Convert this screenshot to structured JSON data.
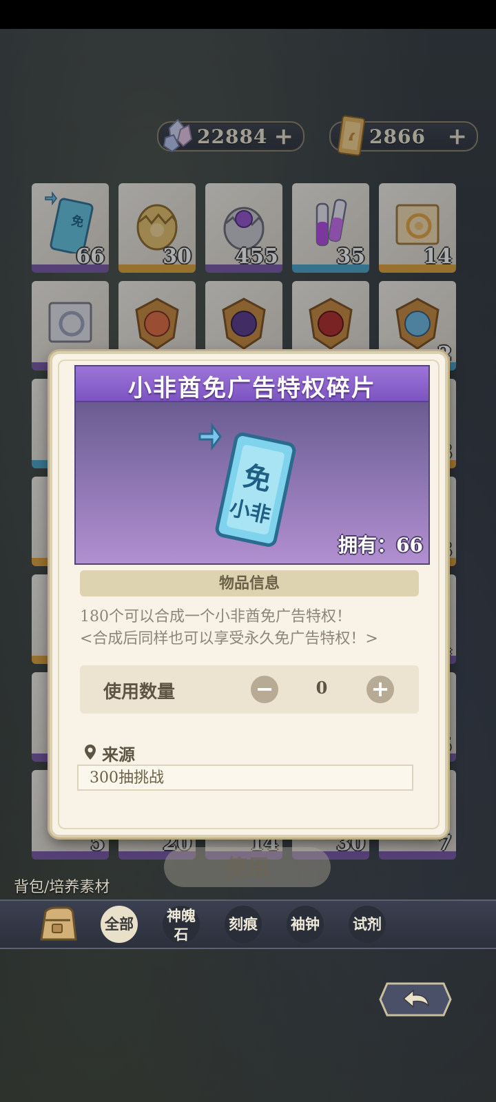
{
  "currency": {
    "gems": "22884",
    "tickets": "2866",
    "plus_symbol": "+"
  },
  "grid": {
    "row1": [
      {
        "count": "66",
        "rarity": "purple",
        "icon": "ad-free-ticket-fragment-icon"
      },
      {
        "count": "30",
        "rarity": "gold",
        "icon": "golden-egg-icon"
      },
      {
        "count": "455",
        "rarity": "purple",
        "icon": "purple-egg-icon"
      },
      {
        "count": "35",
        "rarity": "blue",
        "icon": "potion-vials-icon"
      },
      {
        "count": "14",
        "rarity": "gold",
        "icon": "golden-scroll-icon"
      }
    ],
    "row2_icons": [
      "silver-scroll-icon",
      "fire-emblem-icon",
      "shadow-emblem-icon",
      "dragon-emblem-icon",
      "ice-emblem-icon"
    ],
    "row2_count_last": "2",
    "side_counts_right": [
      "8",
      "8",
      "4",
      "5",
      "5"
    ],
    "row7": [
      {
        "count": "5"
      },
      {
        "count": "20"
      },
      {
        "count": "14"
      },
      {
        "count": "30"
      },
      {
        "count": "7"
      }
    ]
  },
  "dialog": {
    "title": "小非酋免广告特权碎片",
    "owned_label": "拥有：",
    "owned_count": "66",
    "section_title": "物品信息",
    "desc_line1": "180个可以合成一个小非酋免广告特权！",
    "desc_line2": "<合成后同样也可以享受永久免广告特权！>",
    "usage_label": "使用数量",
    "minus": "−",
    "plus": "+",
    "quantity": "0",
    "source_label": "来源",
    "source_value": "300抽挑战"
  },
  "use_button": "使用",
  "breadcrumb": "背包/培养素材",
  "tabs": [
    {
      "label": "全部",
      "active": true
    },
    {
      "label_line1": "神魄",
      "label_line2": "石",
      "active": false
    },
    {
      "label": "刻痕",
      "active": false
    },
    {
      "label": "袖钟",
      "active": false
    },
    {
      "label": "试剂",
      "active": false
    }
  ],
  "colors": {
    "purple_rarity": "#7a58a8",
    "gold_rarity": "#e0a23a",
    "blue_rarity": "#4aa3c9",
    "dialog_bg": "#f8f3e6",
    "title_bar": "#8a64cc"
  }
}
